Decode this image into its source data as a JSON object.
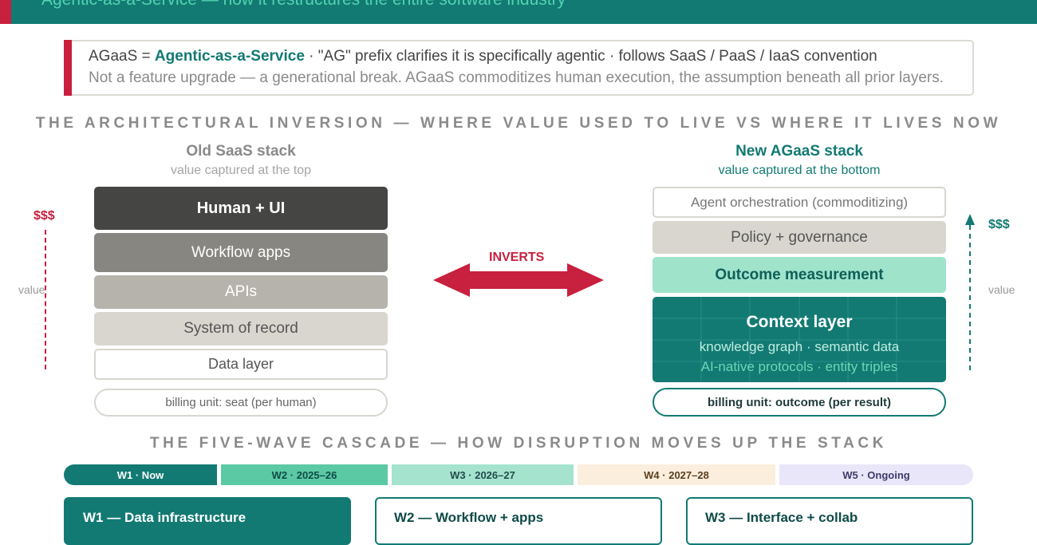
{
  "banner": {
    "title": "Agentic-as-a-Service — how it restructures the entire software industry"
  },
  "definition": {
    "line1_prefix": "AGaaS = ",
    "line1_highlight": "Agentic-as-a-Service",
    "line1_suffix": " · \"AG\" prefix clarifies it is specifically agentic · follows SaaS / PaaS / IaaS convention",
    "line2": "Not a feature upgrade — a generational break. AGaaS commoditizes human execution, the assumption beneath all prior layers."
  },
  "inversion": {
    "section_title": "THE ARCHITECTURAL INVERSION — WHERE VALUE USED TO LIVE VS WHERE IT LIVES NOW",
    "old_stack": {
      "title": "Old SaaS stack",
      "subtitle": "value captured at the top",
      "layers": [
        "Human + UI",
        "Workflow apps",
        "APIs",
        "System of record",
        "Data layer"
      ],
      "billing": "billing unit: seat (per human)",
      "money_label": "$$$",
      "value_label": "value"
    },
    "arrow_label": "INVERTS",
    "new_stack": {
      "title": "New AGaaS stack",
      "subtitle": "value captured at the bottom",
      "layers": [
        "Agent orchestration (commoditizing)",
        "Policy + governance",
        "Outcome measurement"
      ],
      "context": {
        "title": "Context layer",
        "line1": "knowledge graph · semantic data",
        "line2": "AI-native protocols · entity triples"
      },
      "billing": "billing unit: outcome (per result)",
      "money_label": "$$$",
      "value_label": "value"
    }
  },
  "cascade": {
    "section_title": "THE FIVE-WAVE CASCADE — HOW DISRUPTION MOVES UP THE STACK",
    "waves": [
      "W1 · Now",
      "W2 · 2025–26",
      "W3 · 2026–27",
      "W4 · 2027–28",
      "W5 · Ongoing"
    ],
    "cards": [
      "W1 — Data infrastructure",
      "W2 — Workflow + apps",
      "W3 — Interface + collab"
    ]
  },
  "colors": {
    "teal_dark": "#127a73",
    "crimson": "#c8203f",
    "mint": "#9fe3cb",
    "graphite": "#444444"
  }
}
